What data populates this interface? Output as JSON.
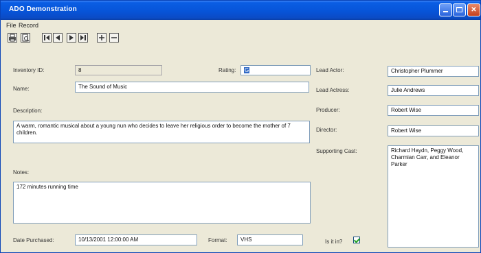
{
  "window": {
    "title": "ADO Demonstration"
  },
  "menu": {
    "items": [
      "File",
      "Record"
    ]
  },
  "toolbar": {
    "buttons": [
      "printer-icon",
      "print-preview-icon",
      "first-record-icon",
      "previous-record-icon",
      "next-record-icon",
      "last-record-icon",
      "add-record-icon",
      "delete-record-icon"
    ]
  },
  "form": {
    "inventory_id": {
      "label": "Inventory ID:",
      "value": "8"
    },
    "rating": {
      "label": "Rating:",
      "value": "G"
    },
    "name": {
      "label": "Name:",
      "value": "The Sound of Music"
    },
    "description": {
      "label": "Description:",
      "value": "A warm, romantic musical about a young nun who decides to leave her religious order to become the mother of 7 children."
    },
    "notes": {
      "label": "Notes:",
      "value": "172 minutes running time"
    },
    "date_purchased": {
      "label": "Date Purchased:",
      "value": "10/13/2001 12:00:00 AM"
    },
    "format": {
      "label": "Format:",
      "value": "VHS"
    },
    "lead_actor": {
      "label": "Lead Actor:",
      "value": "Christopher Plummer"
    },
    "lead_actress": {
      "label": "Lead Actress:",
      "value": "Julie Andrews"
    },
    "producer": {
      "label": "Producer:",
      "value": "Robert Wise"
    },
    "director": {
      "label": "Director:",
      "value": "Robert Wise"
    },
    "supporting_cast": {
      "label": "Supporting Cast:",
      "value": "Richard Haydn, Peggy Wood, Charmian Carr, and Eleanor Parker"
    },
    "is_it_in": {
      "label": "Is it in?",
      "checked": true
    }
  },
  "colors": {
    "titlebar": "#0754d8",
    "window_bg": "#ece9d8",
    "selection": "#316ac5"
  }
}
